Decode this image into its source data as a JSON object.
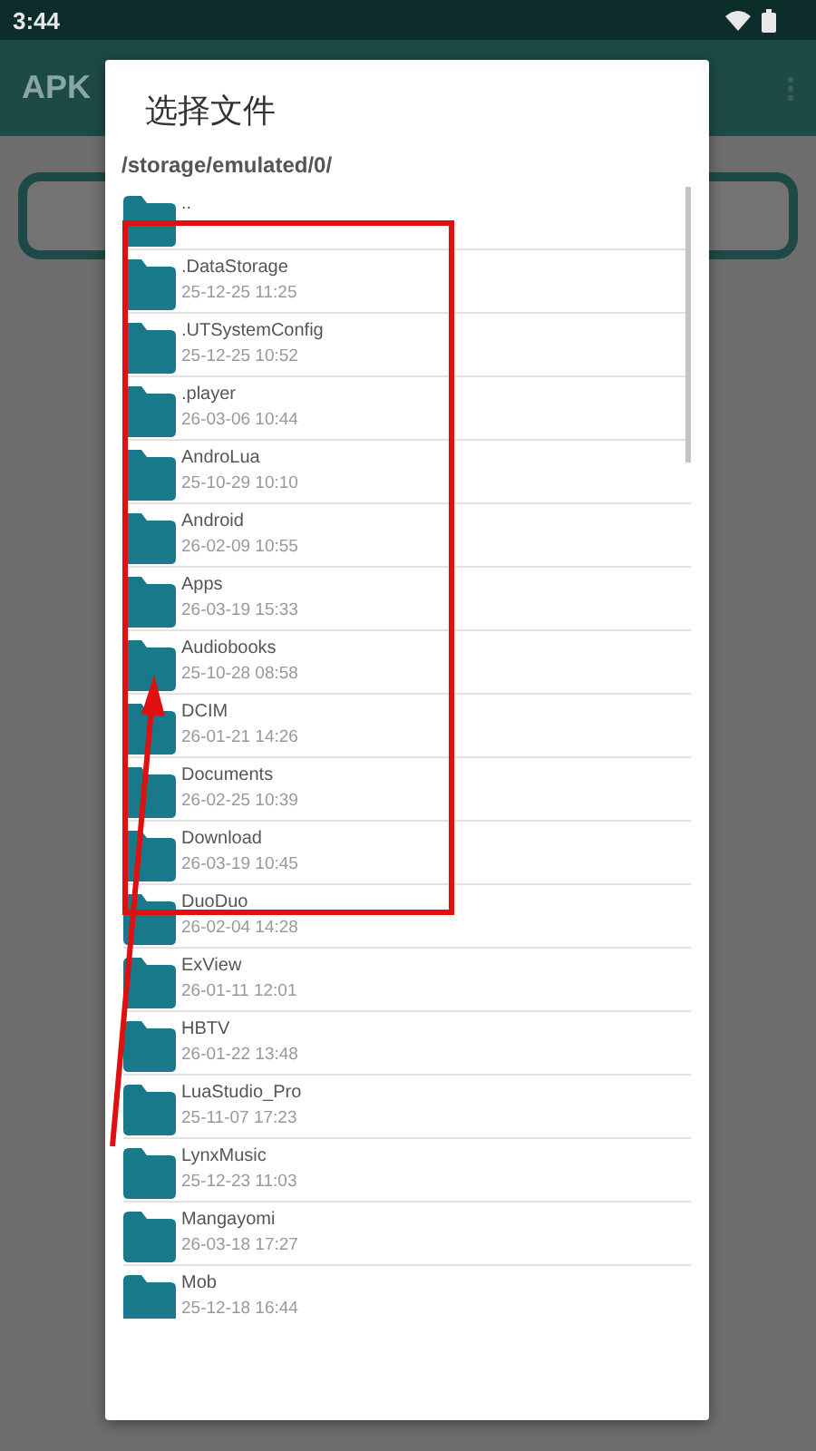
{
  "status_bar": {
    "time": "3:44"
  },
  "app_bar": {
    "title": "APK"
  },
  "dialog": {
    "title": "选择文件",
    "path": "/storage/emulated/0/",
    "items": [
      {
        "name": ".."
      },
      {
        "name": ".DataStorage",
        "date": "25-12-25 11:25"
      },
      {
        "name": ".UTSystemConfig",
        "date": "25-12-25 10:52"
      },
      {
        "name": ".player",
        "date": "26-03-06 10:44"
      },
      {
        "name": "AndroLua",
        "date": "25-10-29 10:10"
      },
      {
        "name": "Android",
        "date": "26-02-09 10:55"
      },
      {
        "name": "Apps",
        "date": "26-03-19 15:33"
      },
      {
        "name": "Audiobooks",
        "date": "25-10-28 08:58"
      },
      {
        "name": "DCIM",
        "date": "26-01-21 14:26"
      },
      {
        "name": "Documents",
        "date": "26-02-25 10:39"
      },
      {
        "name": "Download",
        "date": "26-03-19 10:45"
      },
      {
        "name": "DuoDuo",
        "date": "26-02-04 14:28"
      },
      {
        "name": "ExView",
        "date": "26-01-11 12:01"
      },
      {
        "name": "HBTV",
        "date": "26-01-22 13:48"
      },
      {
        "name": "LuaStudio_Pro",
        "date": "25-11-07 17:23"
      },
      {
        "name": "LynxMusic",
        "date": "25-12-23 11:03"
      },
      {
        "name": "Mangayomi",
        "date": "26-03-18 17:27"
      },
      {
        "name": "Mob",
        "date": "25-12-18 16:44"
      }
    ]
  }
}
